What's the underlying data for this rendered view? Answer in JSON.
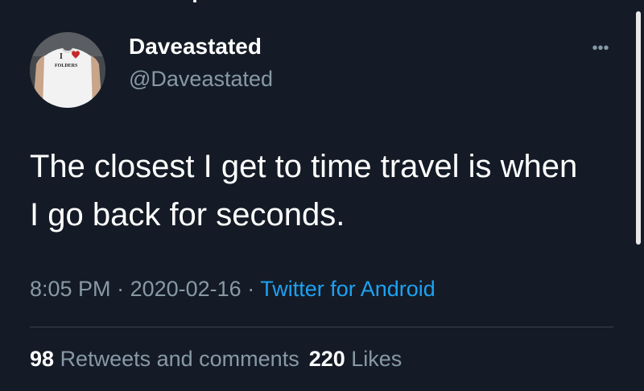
{
  "author": {
    "display_name": "Daveastated",
    "handle": "@Daveastated",
    "avatar_shirt_text_top": "I",
    "avatar_shirt_text_bottom": "FOLDERS"
  },
  "more_icon": "more-horizontal-icon",
  "tweet": {
    "text_line1": "The closest I get to time travel is when",
    "text_line2": "I go back for seconds."
  },
  "meta": {
    "time": "8:05 PM",
    "separator": " · ",
    "date": "2020-02-16",
    "source": "Twitter for Android"
  },
  "stats": {
    "retweets_count": "98",
    "retweets_label": "Retweets and comments",
    "likes_count": "220",
    "likes_label": "Likes"
  },
  "colors": {
    "background": "#141b26",
    "text_primary": "#ffffff",
    "text_secondary": "#8899a6",
    "link": "#1da1f2",
    "divider": "#38444d"
  }
}
